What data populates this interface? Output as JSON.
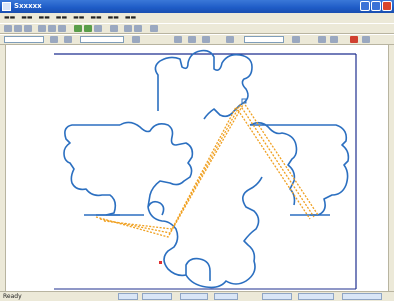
{
  "window": {
    "title": "Sxxxxx"
  },
  "statusbar": {
    "text": "Ready"
  },
  "icons": {
    "app": "app-icon",
    "minimize": "minimize-icon",
    "maximize": "maximize-icon",
    "close": "close-icon"
  },
  "colors": {
    "outline": "#2b6fc0",
    "path": "#f0a020",
    "frame": "#1f2f8f",
    "marker": "#e03030"
  }
}
